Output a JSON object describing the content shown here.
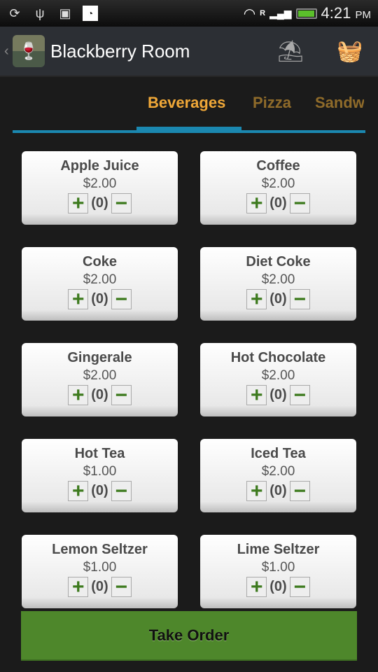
{
  "status_bar": {
    "time": "4:21",
    "ampm": "PM",
    "icons": [
      "sync-icon",
      "usb-icon",
      "android-debug-icon",
      "peapod-icon",
      "wifi-icon",
      "signal-icon",
      "battery-icon"
    ],
    "roaming": "R"
  },
  "action_bar": {
    "title": "Blackberry Room",
    "icons": [
      "back-chevron-icon",
      "app-logo-icon",
      "tables-icon",
      "basket-icon"
    ]
  },
  "tabs": [
    {
      "label": "Beverages",
      "active": true
    },
    {
      "label": "Pizza"
    },
    {
      "label": "Sandw"
    }
  ],
  "items": [
    {
      "name": "Apple Juice",
      "price": "$2.00",
      "qty": "(0)"
    },
    {
      "name": "Coffee",
      "price": "$2.00",
      "qty": "(0)"
    },
    {
      "name": "Coke",
      "price": "$2.00",
      "qty": "(0)"
    },
    {
      "name": "Diet Coke",
      "price": "$2.00",
      "qty": "(0)"
    },
    {
      "name": "Gingerale",
      "price": "$2.00",
      "qty": "(0)"
    },
    {
      "name": "Hot Chocolate",
      "price": "$2.00",
      "qty": "(0)"
    },
    {
      "name": "Hot Tea",
      "price": "$1.00",
      "qty": "(0)"
    },
    {
      "name": "Iced Tea",
      "price": "$2.00",
      "qty": "(0)"
    },
    {
      "name": "Lemon Seltzer",
      "price": "$1.00",
      "qty": "(0)"
    },
    {
      "name": "Lime Seltzer",
      "price": "$1.00",
      "qty": "(0)"
    }
  ],
  "controls": {
    "plus": "+",
    "minus": "−"
  },
  "take_order_label": "Take Order",
  "colors": {
    "accent": "#f0a838",
    "tab_line": "#1b88b0",
    "take_order": "#4e872b"
  }
}
